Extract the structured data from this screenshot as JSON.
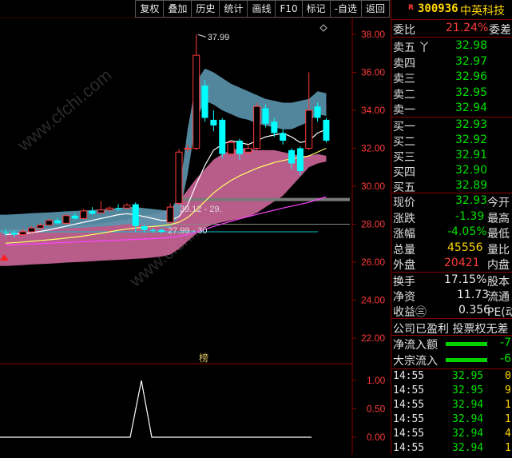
{
  "toolbar": [
    "复权",
    "叠加",
    "历史",
    "统计",
    "画线",
    "F10",
    "标记",
    "-自选",
    "返回"
  ],
  "chart": {
    "price_ticks": [
      "38.00",
      "36.00",
      "34.00",
      "32.00",
      "30.00",
      "28.00",
      "26.00",
      "24.00",
      "22.00"
    ],
    "sub_ticks": [
      "1.00",
      "0.50",
      "0.00"
    ],
    "high_label": "37.99",
    "band_label_1": "29.12 - 29.",
    "band_label_2": "27.99 - 30",
    "marker_label": "榜",
    "watermark": "www.cfchi.com",
    "candles": [
      {
        "o": 27.55,
        "c": 27.5,
        "h": 27.75,
        "l": 27.35
      },
      {
        "o": 27.55,
        "c": 27.45,
        "h": 27.7,
        "l": 27.3
      },
      {
        "o": 27.45,
        "c": 27.6,
        "h": 27.8,
        "l": 27.4
      },
      {
        "o": 27.6,
        "c": 27.8,
        "h": 27.9,
        "l": 27.55
      },
      {
        "o": 27.8,
        "c": 27.95,
        "h": 28.05,
        "l": 27.75
      },
      {
        "o": 27.95,
        "c": 28.2,
        "h": 28.3,
        "l": 27.9
      },
      {
        "o": 28.2,
        "c": 28.05,
        "h": 28.35,
        "l": 28.0
      },
      {
        "o": 28.05,
        "c": 28.45,
        "h": 28.55,
        "l": 28.0
      },
      {
        "o": 28.45,
        "c": 28.3,
        "h": 28.6,
        "l": 28.25
      },
      {
        "o": 28.3,
        "c": 28.7,
        "h": 28.8,
        "l": 28.25
      },
      {
        "o": 28.7,
        "c": 28.55,
        "h": 28.9,
        "l": 28.5
      },
      {
        "o": 28.6,
        "c": 28.75,
        "h": 29.2,
        "l": 28.55
      },
      {
        "o": 28.75,
        "c": 28.85,
        "h": 28.95,
        "l": 28.7
      },
      {
        "o": 28.85,
        "c": 28.8,
        "h": 29.05,
        "l": 28.7
      },
      {
        "o": 28.85,
        "c": 29.0,
        "h": 29.1,
        "l": 28.8
      },
      {
        "o": 29.05,
        "c": 27.9,
        "h": 29.15,
        "l": 27.6
      },
      {
        "o": 27.9,
        "c": 27.7,
        "h": 28.0,
        "l": 27.55
      },
      {
        "o": 27.7,
        "c": 27.65,
        "h": 27.8,
        "l": 27.55
      },
      {
        "o": 27.7,
        "c": 27.6,
        "h": 27.8,
        "l": 27.5
      },
      {
        "o": 28.1,
        "c": 28.9,
        "h": 29.1,
        "l": 28.0
      },
      {
        "o": 29.1,
        "c": 31.8,
        "h": 31.95,
        "l": 29.0
      },
      {
        "o": 32.0,
        "c": 32.0,
        "h": 32.2,
        "l": 31.8
      },
      {
        "o": 32.0,
        "c": 36.9,
        "h": 37.99,
        "l": 31.9
      },
      {
        "o": 35.3,
        "c": 33.6,
        "h": 35.6,
        "l": 33.4
      },
      {
        "o": 33.5,
        "c": 33.2,
        "h": 34.0,
        "l": 32.9
      },
      {
        "o": 33.5,
        "c": 31.7,
        "h": 33.6,
        "l": 31.5
      },
      {
        "o": 31.7,
        "c": 32.3,
        "h": 32.4,
        "l": 31.6
      },
      {
        "o": 32.4,
        "c": 31.7,
        "h": 32.5,
        "l": 31.4
      },
      {
        "o": 31.8,
        "c": 32.0,
        "h": 32.2,
        "l": 31.7
      },
      {
        "o": 32.0,
        "c": 34.2,
        "h": 34.4,
        "l": 31.9
      },
      {
        "o": 34.1,
        "c": 33.3,
        "h": 34.3,
        "l": 33.1
      },
      {
        "o": 33.4,
        "c": 32.8,
        "h": 33.6,
        "l": 32.6
      },
      {
        "o": 32.8,
        "c": 32.4,
        "h": 33.0,
        "l": 32.2
      },
      {
        "o": 31.9,
        "c": 31.2,
        "h": 32.0,
        "l": 30.9
      },
      {
        "o": 32.0,
        "c": 30.8,
        "h": 32.1,
        "l": 30.6
      },
      {
        "o": 32.0,
        "c": 34.0,
        "h": 36.0,
        "l": 31.9
      },
      {
        "o": 34.2,
        "c": 33.6,
        "h": 34.4,
        "l": 33.4
      },
      {
        "o": 33.5,
        "c": 32.4,
        "h": 33.6,
        "l": 32.3
      }
    ]
  },
  "stock": {
    "code": "300936",
    "name": "中英科技",
    "mark": "R"
  },
  "ratio": {
    "label": "委比",
    "value": "21.24%",
    "diff_label": "委差"
  },
  "sells": [
    {
      "label": "卖五",
      "extra": "丫",
      "price": "32.98"
    },
    {
      "label": "卖四",
      "extra": "",
      "price": "32.97"
    },
    {
      "label": "卖三",
      "extra": "",
      "price": "32.96"
    },
    {
      "label": "卖二",
      "extra": "",
      "price": "32.95"
    },
    {
      "label": "卖一",
      "extra": "",
      "price": "32.94"
    }
  ],
  "buys": [
    {
      "label": "买一",
      "price": "32.93"
    },
    {
      "label": "买二",
      "price": "32.92"
    },
    {
      "label": "买三",
      "price": "32.91"
    },
    {
      "label": "买四",
      "price": "32.90"
    },
    {
      "label": "买五",
      "price": "32.89"
    }
  ],
  "quote": [
    {
      "label": "现价",
      "value": "32.93",
      "cls": "dn",
      "right": "今开"
    },
    {
      "label": "涨跌",
      "value": "-1.39",
      "cls": "dn",
      "right": "最高"
    },
    {
      "label": "涨幅",
      "value": "-4.05%",
      "cls": "dn",
      "right": "最低"
    },
    {
      "label": "总量",
      "value": "45556",
      "cls": "yel",
      "right": "量比"
    },
    {
      "label": "外盘",
      "value": "20421",
      "cls": "up",
      "right": "内盘"
    }
  ],
  "fund": [
    {
      "label": "换手",
      "value": "17.15%",
      "right": "股本"
    },
    {
      "label": "净资",
      "value": "11.73",
      "right": "流通"
    },
    {
      "label": "收益㊂",
      "value": "0.356",
      "right": "PE(动"
    }
  ],
  "notice": "公司已盈利 投票权无差",
  "flows": [
    {
      "label": "净流入额",
      "value": "-7"
    },
    {
      "label": "大宗流入",
      "value": "-6"
    }
  ],
  "trades": [
    {
      "time": "14:55",
      "price": "32.95",
      "vol": "0"
    },
    {
      "time": "14:55",
      "price": "32.95",
      "vol": "9"
    },
    {
      "time": "14:55",
      "price": "32.94",
      "vol": "1"
    },
    {
      "time": "14:55",
      "price": "32.94",
      "vol": "1"
    },
    {
      "time": "14:55",
      "price": "32.94",
      "vol": "4"
    },
    {
      "time": "14:55",
      "price": "32.94",
      "vol": "1"
    }
  ],
  "colors": {
    "up": "#ff3b3b",
    "down": "#00ffff",
    "ma5": "#ffffff",
    "ma10": "#ffff66",
    "ma20": "#ff44ff",
    "band_pink": "#c86496",
    "band_blue": "#5b95ad"
  }
}
